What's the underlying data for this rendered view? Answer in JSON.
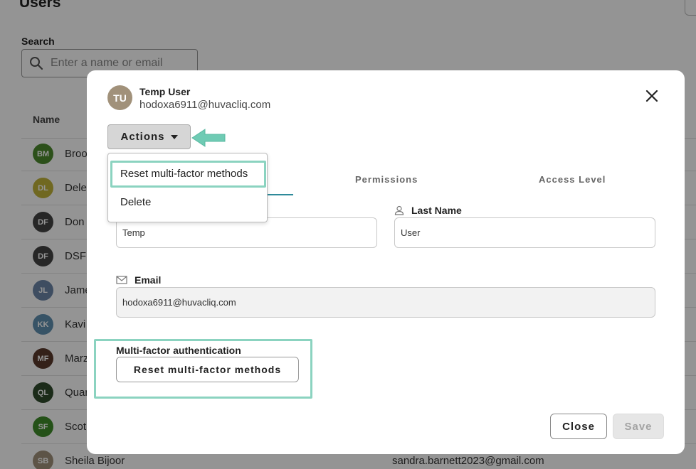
{
  "page": {
    "title": "Users",
    "search": {
      "label": "Search",
      "placeholder": "Enter a name or email"
    },
    "table": {
      "name_header": "Name",
      "rows": [
        {
          "initials": "BM",
          "name": "Broo",
          "email": "",
          "color": "#4c8a2e"
        },
        {
          "initials": "DL",
          "name": "Dele",
          "email": "",
          "color": "#c2b33a"
        },
        {
          "initials": "DF",
          "name": "Don",
          "email": "",
          "color": "#444444"
        },
        {
          "initials": "DF",
          "name": "DSF",
          "email": "",
          "color": "#444444"
        },
        {
          "initials": "JL",
          "name": "Jame",
          "email": "",
          "color": "#6b85a8"
        },
        {
          "initials": "KK",
          "name": "Kavi",
          "email": "",
          "color": "#5f8fb0"
        },
        {
          "initials": "MF",
          "name": "Marz",
          "email": "",
          "color": "#5a3a2c"
        },
        {
          "initials": "QL",
          "name": "Quar",
          "email": "",
          "color": "#2f4a2c"
        },
        {
          "initials": "SF",
          "name": "Scot",
          "email": "",
          "color": "#3f8c2a"
        },
        {
          "initials": "SB",
          "name": "Sheila Bijoor",
          "email": "sandra.barnett2023@gmail.com",
          "color": "#a1917a"
        }
      ]
    }
  },
  "modal": {
    "user": {
      "initials": "TU",
      "name": "Temp User",
      "email": "hodoxa6911@huvacliq.com",
      "avatar_color": "#a1917a"
    },
    "actions_label": "Actions",
    "dropdown": {
      "items": [
        "Reset multi-factor methods",
        "Delete"
      ]
    },
    "tabs": [
      "Permissions",
      "Access Level"
    ],
    "fields": {
      "last_name": {
        "label": "Last Name",
        "value": "User"
      },
      "first_name": {
        "value": "Temp"
      },
      "email": {
        "label": "Email",
        "value": "hodoxa6911@huvacliq.com"
      }
    },
    "mfa": {
      "label": "Multi-factor authentication",
      "button": "Reset multi-factor methods"
    },
    "footer": {
      "close": "Close",
      "save": "Save"
    }
  },
  "colors": {
    "highlight": "#8bd3c0",
    "tab_accent": "#2e8a9a",
    "overlay": "rgba(0,0,0,0.42)"
  },
  "icons": [
    "search-icon",
    "close-icon",
    "caret-down-icon",
    "arrow-left-icon",
    "person-icon",
    "mail-icon"
  ]
}
